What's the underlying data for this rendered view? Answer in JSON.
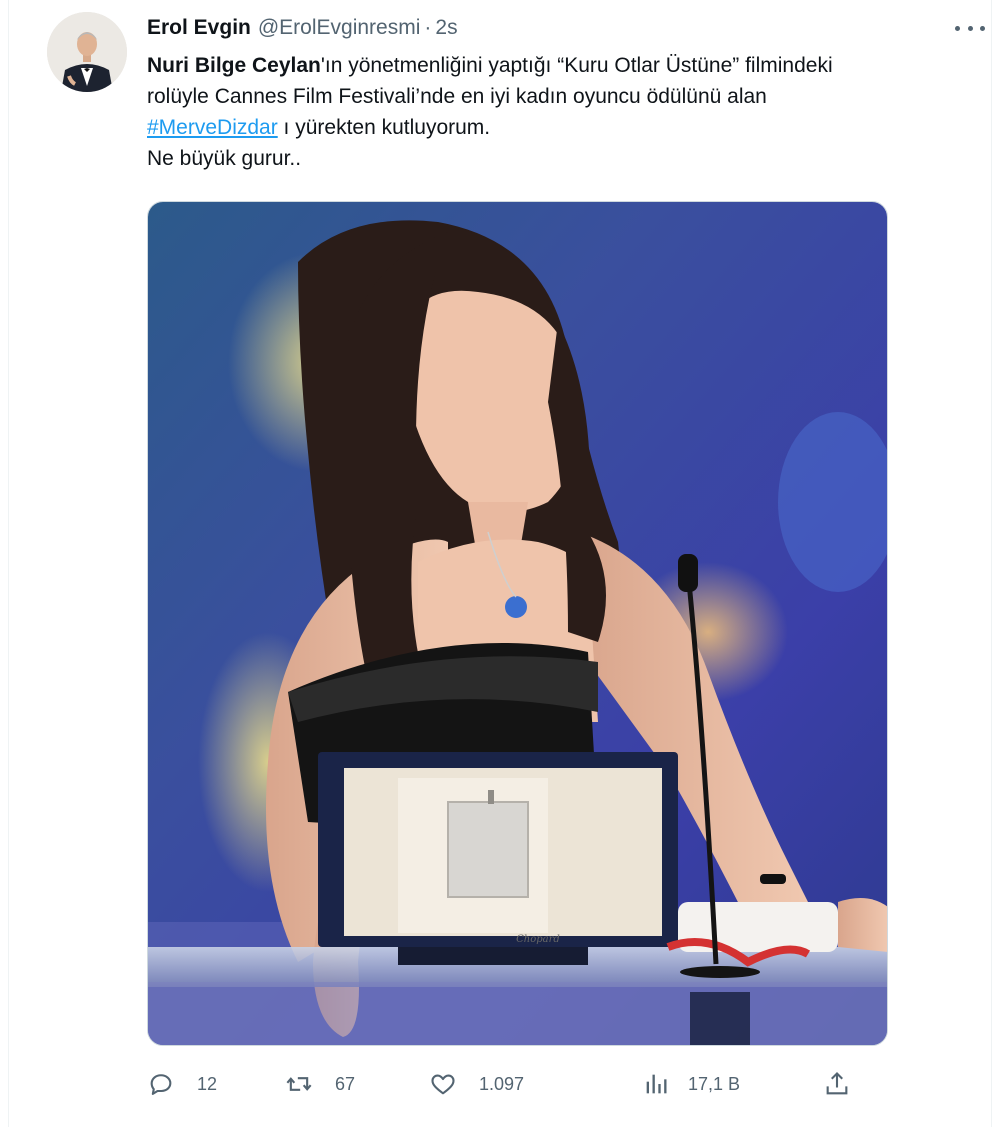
{
  "tweet": {
    "author_name": "Erol Evgin",
    "author_handle": "@ErolEvginresmi",
    "separator": "·",
    "time": "2s",
    "text": {
      "bold_name": "Nuri Bilge Ceylan",
      "line1_rest": "'ın yönetmenliğini yaptığı “Kuru Otlar Üstüne” filmindeki",
      "line2": "rolüyle Cannes Film Festivali’nde en iyi kadın oyuncu ödülünü alan",
      "hashtag": "#MerveDizdar",
      "line3_rest": " ı yürekten kutluyorum.",
      "line4": "Ne büyük gurur.."
    },
    "media": {
      "plaque_text": "Chopard"
    },
    "actions": {
      "reply_icon": "reply-icon",
      "reply_count": "12",
      "retweet_icon": "retweet-icon",
      "retweet_count": "67",
      "like_icon": "heart-icon",
      "like_count": "1.097",
      "views_icon": "views-chart-icon",
      "views_count": "17,1 B",
      "share_icon": "share-icon"
    },
    "more_icon": "more-horizontal-icon"
  },
  "colors": {
    "text_primary": "#0f1419",
    "text_secondary": "#536471",
    "link": "#1d9bf0"
  }
}
